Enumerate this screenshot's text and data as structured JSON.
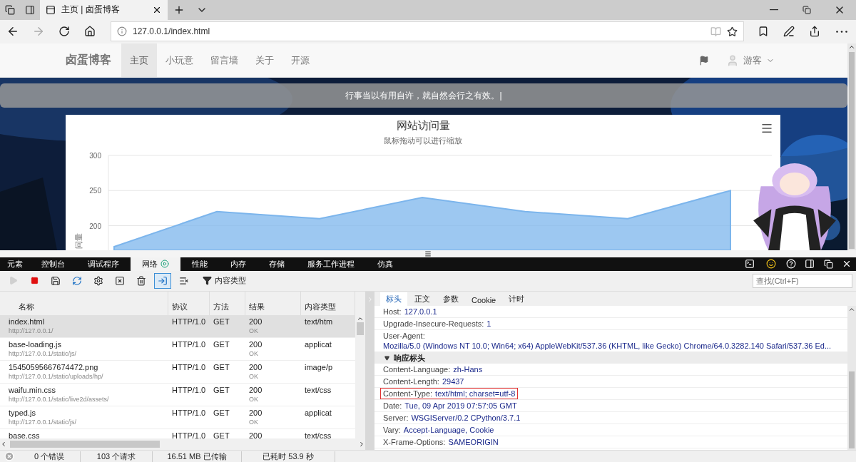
{
  "browser": {
    "tab": {
      "title": "主页 | 卤蛋博客"
    },
    "address": "127.0.0.1/index.html"
  },
  "site": {
    "brand": "卤蛋博客",
    "nav": [
      {
        "label": "主页",
        "selected": true
      },
      {
        "label": "小玩意",
        "selected": false
      },
      {
        "label": "留言墙",
        "selected": false
      },
      {
        "label": "关于",
        "selected": false
      },
      {
        "label": "开源",
        "selected": false
      }
    ],
    "user": "游客",
    "motto": "行事当以有用自许，就自然会行之有效。|",
    "chart": {
      "subtitle": "鼠标拖动可以进行缩放",
      "chart_data": {
        "type": "area",
        "title": "网站访问量",
        "ylabel": "问量",
        "grid": true,
        "ylim": [
          165,
          300
        ],
        "yticks": [
          200,
          250,
          300
        ],
        "series": [
          {
            "color": "#7cb5ec",
            "values": [
              170,
              220,
              210,
              240,
              220,
              210,
              250
            ]
          }
        ]
      }
    }
  },
  "devtools": {
    "tabs": [
      {
        "label": "元素",
        "selected": false
      },
      {
        "label": "控制台",
        "selected": false
      },
      {
        "label": "调试程序",
        "selected": false
      },
      {
        "label": "网络",
        "selected": true
      },
      {
        "label": "性能",
        "selected": false
      },
      {
        "label": "内存",
        "selected": false
      },
      {
        "label": "存储",
        "selected": false
      },
      {
        "label": "服务工作进程",
        "selected": false
      },
      {
        "label": "仿真",
        "selected": false
      }
    ],
    "tools": [
      {
        "kind": "play",
        "disabled": true,
        "active": false
      },
      {
        "kind": "stop",
        "disabled": false,
        "active": false
      },
      {
        "kind": "save",
        "disabled": false,
        "active": false
      },
      {
        "kind": "refresh",
        "disabled": false,
        "active": false
      },
      {
        "kind": "settings",
        "disabled": false,
        "active": false
      },
      {
        "kind": "clear-window",
        "disabled": false,
        "active": false
      },
      {
        "kind": "clear-cache",
        "disabled": false,
        "active": false
      },
      {
        "kind": "clear-navigate",
        "disabled": false,
        "active": true
      },
      {
        "kind": "clear-list",
        "disabled": false,
        "active": false
      }
    ],
    "filter": "内容类型",
    "search": {
      "placeholder": "查找(Ctrl+F)"
    }
  },
  "requests": {
    "columns": [
      "名称",
      "协议",
      "方法",
      "结果",
      "内容类型"
    ],
    "rows": [
      {
        "name": "index.html",
        "url": "http://127.0.0.1/",
        "protocol": "HTTP/1.0",
        "method": "GET",
        "status": "200",
        "status_text": "OK",
        "type": "text/htm",
        "selected": true
      },
      {
        "name": "base-loading.js",
        "url": "http://127.0.0.1/static/js/",
        "protocol": "HTTP/1.0",
        "method": "GET",
        "status": "200",
        "status_text": "OK",
        "type": "applicat",
        "selected": false
      },
      {
        "name": "15450595667674472.png",
        "url": "http://127.0.0.1/static/uploads/hp/",
        "protocol": "HTTP/1.0",
        "method": "GET",
        "status": "200",
        "status_text": "OK",
        "type": "image/p",
        "selected": false
      },
      {
        "name": "waifu.min.css",
        "url": "http://127.0.0.1/static/live2d/assets/",
        "protocol": "HTTP/1.0",
        "method": "GET",
        "status": "200",
        "status_text": "OK",
        "type": "text/css",
        "selected": false
      },
      {
        "name": "typed.js",
        "url": "http://127.0.0.1/static/js/",
        "protocol": "HTTP/1.0",
        "method": "GET",
        "status": "200",
        "status_text": "OK",
        "type": "applicat",
        "selected": false
      },
      {
        "name": "base.css",
        "protocol": "HTTP/1.0",
        "method": "GET",
        "status": "200",
        "type": "text/css",
        "selected": false
      }
    ]
  },
  "details": {
    "tabs": [
      {
        "label": "标头",
        "selected": true
      },
      {
        "label": "正文",
        "selected": false
      },
      {
        "label": "参数",
        "selected": false
      },
      {
        "label": "Cookie",
        "selected": false
      },
      {
        "label": "计时",
        "selected": false
      }
    ],
    "rows": [
      {
        "kind": "header",
        "name": "Host:",
        "value": "127.0.0.1",
        "highlighted": false
      },
      {
        "kind": "header",
        "name": "Upgrade-Insecure-Requests:",
        "value": "1",
        "highlighted": false
      },
      {
        "kind": "header",
        "name": "User-Agent:",
        "value": "Mozilla/5.0 (Windows NT 10.0; Win64; x64) AppleWebKit/537.36 (KHTML, like Gecko) Chrome/64.0.3282.140 Safari/537.36 Ed...",
        "highlighted": false
      },
      {
        "kind": "section",
        "label": "响应标头",
        "expanded": true
      },
      {
        "kind": "header",
        "name": "Content-Language:",
        "value": "zh-Hans",
        "highlighted": false
      },
      {
        "kind": "header",
        "name": "Content-Length:",
        "value": "29437",
        "highlighted": false
      },
      {
        "kind": "header",
        "name": "Content-Type:",
        "value": "text/html; charset=utf-8",
        "highlighted": true
      },
      {
        "kind": "header",
        "name": "Date:",
        "value": "Tue, 09 Apr 2019 07:57:05 GMT",
        "highlighted": false
      },
      {
        "kind": "header",
        "name": "Server:",
        "value": "WSGIServer/0.2 CPython/3.7.1",
        "highlighted": false
      },
      {
        "kind": "header",
        "name": "Vary:",
        "value": "Accept-Language, Cookie",
        "highlighted": false
      },
      {
        "kind": "header",
        "name": "X-Frame-Options:",
        "value": "SAMEORIGIN",
        "highlighted": false
      }
    ]
  },
  "status_bar": {
    "errors": "0 个错误",
    "requests": "103 个请求",
    "transferred": "16.51 MB 已传输",
    "elapsed": "已耗时 53.9 秒"
  }
}
